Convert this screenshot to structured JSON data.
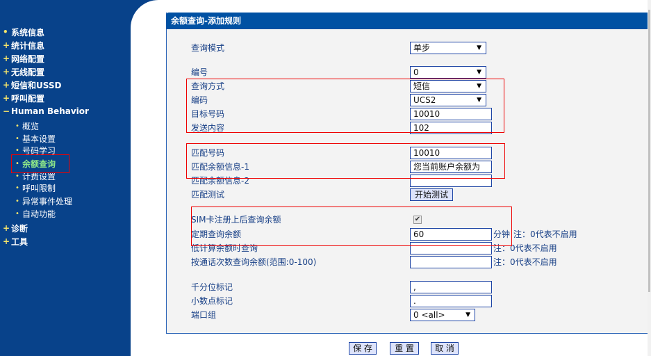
{
  "sidebar": {
    "top_items": [
      {
        "mark": "•",
        "label": "系统信息"
      },
      {
        "mark": "+",
        "label": "统计信息"
      },
      {
        "mark": "+",
        "label": "网络配置"
      },
      {
        "mark": "+",
        "label": "无线配置"
      },
      {
        "mark": "+",
        "label": "短信和USSD"
      },
      {
        "mark": "+",
        "label": "呼叫配置"
      },
      {
        "mark": "−",
        "label": "Human Behavior"
      }
    ],
    "sub_items": [
      {
        "label": "概览"
      },
      {
        "label": "基本设置"
      },
      {
        "label": "号码学习"
      },
      {
        "label": "余额查询",
        "active": true
      },
      {
        "label": "计费设置"
      },
      {
        "label": "呼叫限制"
      },
      {
        "label": "异常事件处理"
      },
      {
        "label": "自动功能"
      }
    ],
    "bottom_items": [
      {
        "mark": "+",
        "label": "诊断"
      },
      {
        "mark": "+",
        "label": "工具"
      }
    ],
    "bullet": "•"
  },
  "panel": {
    "title": "余额查询-添加规则",
    "fields": {
      "query_mode": {
        "label": "查询模式",
        "value": "单步"
      },
      "index": {
        "label": "编号",
        "value": "0"
      },
      "query_method": {
        "label": "查询方式",
        "value": "短信"
      },
      "encoding": {
        "label": "编码",
        "value": "UCS2"
      },
      "target_number": {
        "label": "目标号码",
        "value": "10010"
      },
      "send_content": {
        "label": "发送内容",
        "value": "102"
      },
      "match_number": {
        "label": "匹配号码",
        "value": "10010"
      },
      "match_balance_1": {
        "label": "匹配余额信息-1",
        "value": "您当前账户余额为"
      },
      "match_balance_2": {
        "label": "匹配余额信息-2",
        "value": ""
      },
      "match_test": {
        "label": "匹配测试",
        "button": "开始测试"
      },
      "sim_register_query": {
        "label": "SIM卡注册上后查询余额",
        "checked": true,
        "check_glyph": "✔"
      },
      "periodic_query": {
        "label": "定期查询余额",
        "value": "60",
        "unit": "分钟",
        "note": "注：0代表不启用"
      },
      "low_balance_query": {
        "label": "低计算余额时查询",
        "value": "",
        "note": "注：0代表不启用"
      },
      "call_count_query": {
        "label": "按通话次数查询余额(范围:0-100)",
        "value": "",
        "note": "注：0代表不启用"
      },
      "thousands_sep": {
        "label": "千分位标记",
        "value": ","
      },
      "decimal_mark": {
        "label": "小数点标记",
        "value": "."
      },
      "port_group": {
        "label": "端口组",
        "value": "0 <all>"
      }
    },
    "dropdown_arrow": "▼"
  },
  "footer": {
    "save": "保 存",
    "reset": "重 置",
    "cancel": "取 消"
  }
}
